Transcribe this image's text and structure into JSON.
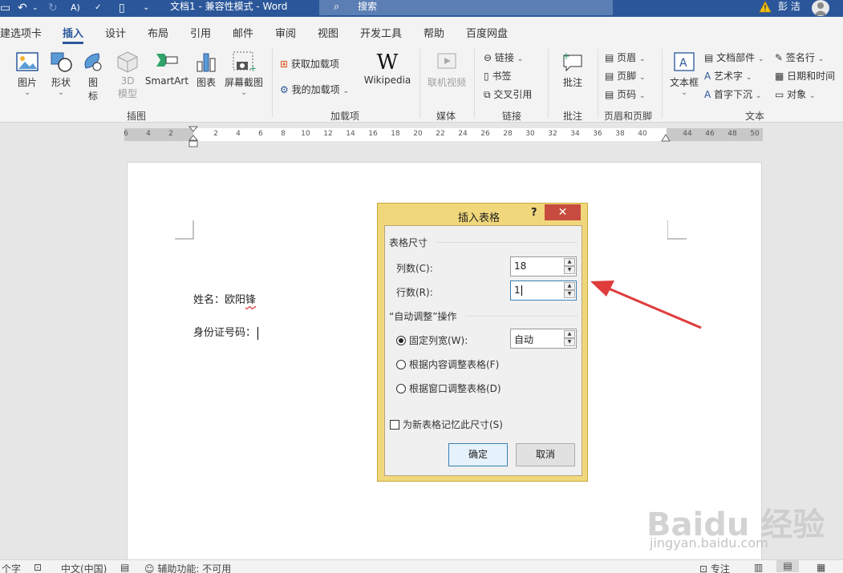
{
  "titlebar": {
    "document_title": "文档1 - 兼容性模式 - Word",
    "search_placeholder": "搜索",
    "user_name": "彭 洁"
  },
  "tabs": [
    {
      "label": "建选项卡"
    },
    {
      "label": "插入"
    },
    {
      "label": "设计"
    },
    {
      "label": "布局"
    },
    {
      "label": "引用"
    },
    {
      "label": "邮件"
    },
    {
      "label": "审阅"
    },
    {
      "label": "视图"
    },
    {
      "label": "开发工具"
    },
    {
      "label": "帮助"
    },
    {
      "label": "百度网盘"
    }
  ],
  "ribbon": {
    "illustrations": {
      "picture": "图片",
      "shapes": "形状",
      "icons_1": "图",
      "icons_2": "标",
      "model3d_1": "3D",
      "model3d_2": "模型",
      "smartart": "SmartArt",
      "chart": "图表",
      "screenshot": "屏幕截图",
      "group": "插图"
    },
    "addins": {
      "get": "获取加载项",
      "my": "我的加载项",
      "wikipedia": "Wikipedia",
      "group": "加载项"
    },
    "media": {
      "online_video": "联机视频",
      "group": "媒体"
    },
    "links": {
      "link": "链接",
      "bookmark": "书签",
      "crossref": "交叉引用",
      "group": "链接"
    },
    "comments": {
      "comment": "批注",
      "group": "批注"
    },
    "header_footer": {
      "header": "页眉",
      "footer": "页脚",
      "page_number": "页码",
      "group": "页眉和页脚"
    },
    "text": {
      "textbox": "文本框",
      "quickparts": "文档部件",
      "wordart": "艺术字",
      "dropcap": "首字下沉",
      "signature": "签名行",
      "datetime": "日期和时间",
      "object": "对象",
      "group": "文本"
    }
  },
  "ruler_ticks": [
    "6",
    "4",
    "2",
    "2",
    "4",
    "6",
    "8",
    "10",
    "12",
    "14",
    "16",
    "18",
    "20",
    "22",
    "24",
    "26",
    "28",
    "30",
    "32",
    "34",
    "36",
    "38",
    "40",
    "44",
    "46",
    "48",
    "50"
  ],
  "document": {
    "line1": "姓名：欧阳",
    "line1_squiggle": "锋",
    "line2": "身份证号码："
  },
  "dialog": {
    "title": "插入表格",
    "help": "?",
    "close": "✕",
    "size_section": "表格尺寸",
    "columns_label": "列数(C):",
    "columns_value": "18",
    "rows_label": "行数(R):",
    "rows_value": "1",
    "autofit_section": "“自动调整”操作",
    "fixed_width": "固定列宽(W):",
    "fixed_width_value": "自动",
    "autofit_contents": "根据内容调整表格(F)",
    "autofit_window": "根据窗口调整表格(D)",
    "remember": "为新表格记忆此尺寸(S)",
    "ok": "确定",
    "cancel": "取消"
  },
  "statusbar": {
    "words": "个字",
    "language": "中文(中国)",
    "accessibility": "辅助功能: 不可用",
    "focus": "专注"
  },
  "watermark": {
    "main": "Baidu 经验",
    "sub": "jingyan.baidu.com"
  },
  "colors": {
    "brand": "#2b579a",
    "dialog_frame": "#f0d77b",
    "close_button": "#c74b3e",
    "arrow": "#e03c3c"
  }
}
